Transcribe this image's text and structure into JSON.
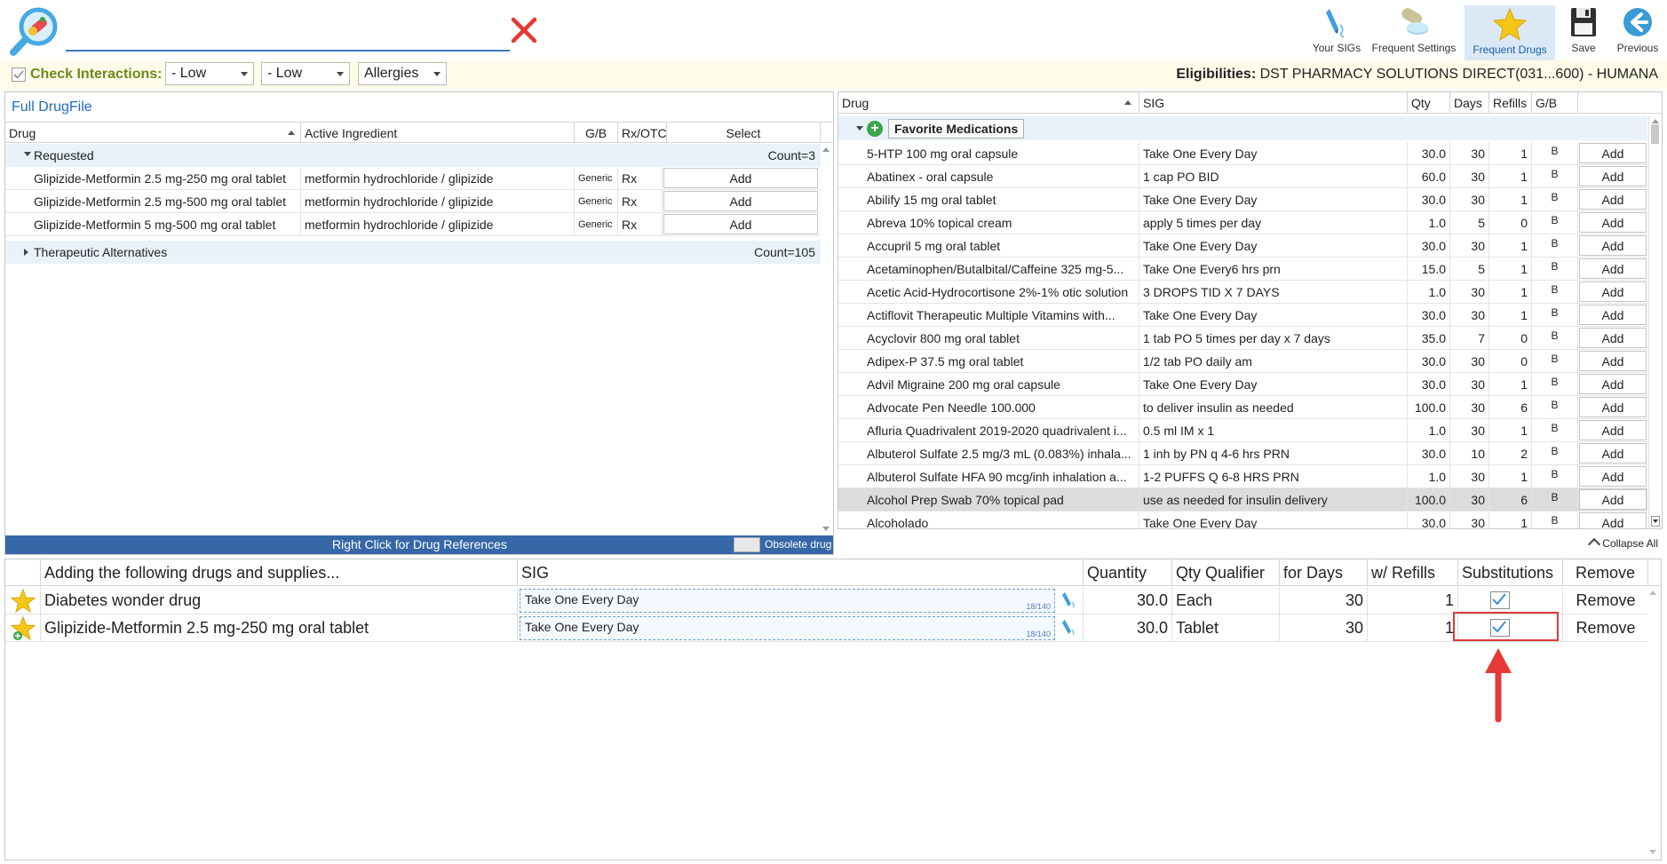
{
  "search": {
    "value": "",
    "placeholder": ""
  },
  "toolbar": {
    "your_sigs": "Your SIGs",
    "frequent_settings": "Frequent Settings",
    "frequent_drugs": "Frequent Drugs",
    "save": "Save",
    "previous": "Previous"
  },
  "interactions": {
    "label": "Check Interactions:",
    "checked": true,
    "severity1": "- Low",
    "severity2": "- Low",
    "allergies": "Allergies"
  },
  "eligibility": {
    "label": "Eligibilities:",
    "value": "DST PHARMACY SOLUTIONS DIRECT(031...600) - HUMANA"
  },
  "left_panel": {
    "title": "Full DrugFile",
    "columns": [
      "Drug",
      "Active Ingredient",
      "G/B",
      "Rx/OTC",
      "Select"
    ],
    "groups": [
      {
        "name": "Requested",
        "count": "Count=3",
        "rows": [
          {
            "drug": "Glipizide-Metformin 2.5 mg-250 mg oral tablet",
            "ingredient": "metformin hydrochloride / glipizide",
            "gb": "Generic",
            "rxotc": "Rx",
            "action": "Add"
          },
          {
            "drug": "Glipizide-Metformin 2.5 mg-500 mg oral tablet",
            "ingredient": "metformin hydrochloride / glipizide",
            "gb": "Generic",
            "rxotc": "Rx",
            "action": "Add"
          },
          {
            "drug": "Glipizide-Metformin 5 mg-500 mg oral tablet",
            "ingredient": "metformin hydrochloride / glipizide",
            "gb": "Generic",
            "rxotc": "Rx",
            "action": "Add"
          }
        ]
      },
      {
        "name": "Therapeutic Alternatives",
        "count": "Count=105"
      }
    ],
    "footer": "Right Click for Drug References",
    "obsolete_label": "Obsolete drug"
  },
  "right_panel": {
    "columns": [
      "Drug",
      "SIG",
      "Qty",
      "Days",
      "Refills",
      "G/B"
    ],
    "group_label": "Favorite Medications",
    "rows": [
      {
        "drug": "5-HTP 100 mg oral capsule",
        "sig": "Take One Every Day",
        "qty": "30.0",
        "days": "30",
        "refills": "1",
        "gb": "B",
        "action": "Add"
      },
      {
        "drug": "Abatinex - oral capsule",
        "sig": "1 cap PO BID",
        "qty": "60.0",
        "days": "30",
        "refills": "1",
        "gb": "B",
        "action": "Add"
      },
      {
        "drug": "Abilify 15 mg oral tablet",
        "sig": "Take One Every Day",
        "qty": "30.0",
        "days": "30",
        "refills": "1",
        "gb": "B",
        "action": "Add"
      },
      {
        "drug": "Abreva 10% topical cream",
        "sig": "apply 5 times per day",
        "qty": "1.0",
        "days": "5",
        "refills": "0",
        "gb": "B",
        "action": "Add"
      },
      {
        "drug": "Accupril 5 mg oral tablet",
        "sig": "Take One Every Day",
        "qty": "30.0",
        "days": "30",
        "refills": "1",
        "gb": "B",
        "action": "Add"
      },
      {
        "drug": "Acetaminophen/Butalbital/Caffeine 325 mg-5...",
        "sig": "Take One Every6 hrs prn",
        "qty": "15.0",
        "days": "5",
        "refills": "1",
        "gb": "B",
        "action": "Add"
      },
      {
        "drug": "Acetic Acid-Hydrocortisone 2%-1% otic solution",
        "sig": "3 DROPS TID X 7 DAYS",
        "qty": "1.0",
        "days": "30",
        "refills": "1",
        "gb": "B",
        "action": "Add"
      },
      {
        "drug": "Actiflovit Therapeutic Multiple Vitamins with...",
        "sig": "Take One Every Day",
        "qty": "30.0",
        "days": "30",
        "refills": "1",
        "gb": "B",
        "action": "Add"
      },
      {
        "drug": "Acyclovir 800 mg oral tablet",
        "sig": "1 tab PO 5 times per day x 7 days",
        "qty": "35.0",
        "days": "7",
        "refills": "0",
        "gb": "B",
        "action": "Add"
      },
      {
        "drug": "Adipex-P 37.5 mg oral tablet",
        "sig": "1/2 tab PO daily am",
        "qty": "30.0",
        "days": "30",
        "refills": "0",
        "gb": "B",
        "action": "Add"
      },
      {
        "drug": "Advil Migraine 200 mg oral capsule",
        "sig": "Take One Every Day",
        "qty": "30.0",
        "days": "30",
        "refills": "1",
        "gb": "B",
        "action": "Add"
      },
      {
        "drug": "Advocate Pen Needle 100.000",
        "sig": "to deliver insulin as needed",
        "qty": "100.0",
        "days": "30",
        "refills": "6",
        "gb": "B",
        "action": "Add"
      },
      {
        "drug": "Afluria Quadrivalent 2019-2020 quadrivalent i...",
        "sig": "0.5 ml IM x 1",
        "qty": "1.0",
        "days": "30",
        "refills": "1",
        "gb": "B",
        "action": "Add"
      },
      {
        "drug": "Albuterol Sulfate 2.5 mg/3 mL (0.083%) inhala...",
        "sig": "1 inh by PN q 4-6 hrs PRN",
        "qty": "30.0",
        "days": "10",
        "refills": "2",
        "gb": "B",
        "action": "Add"
      },
      {
        "drug": "Albuterol Sulfate HFA 90 mcg/inh inhalation a...",
        "sig": "1-2 PUFFS Q 6-8 HRS PRN",
        "qty": "1.0",
        "days": "30",
        "refills": "1",
        "gb": "B",
        "action": "Add"
      },
      {
        "drug": "Alcohol Prep Swab 70% topical pad",
        "sig": "use as needed for insulin delivery",
        "qty": "100.0",
        "days": "30",
        "refills": "6",
        "gb": "B",
        "action": "Add",
        "selected": true
      },
      {
        "drug": "Alcoholado",
        "sig": "Take One Every Day",
        "qty": "30.0",
        "days": "30",
        "refills": "1",
        "gb": "B",
        "action": "Add"
      }
    ],
    "collapse_label": "Collapse All"
  },
  "bottom_panel": {
    "columns": [
      "Adding the following drugs and supplies...",
      "SIG",
      "Quantity",
      "Qty Qualifier",
      "for Days",
      "w/ Refills",
      "Substitutions",
      "Remove"
    ],
    "rows": [
      {
        "drug": "Diabetes wonder drug",
        "sig": "Take One Every Day",
        "sig_count": "18/140",
        "quantity": "30.0",
        "qualifier": "Each",
        "days": "30",
        "refills": "1",
        "substitutions": true,
        "remove": "Remove"
      },
      {
        "drug": "Glipizide-Metformin 2.5 mg-250 mg oral tablet",
        "sig": "Take One Every Day",
        "sig_count": "18/140",
        "quantity": "30.0",
        "qualifier": "Tablet",
        "days": "30",
        "refills": "1",
        "substitutions": true,
        "remove": "Remove"
      }
    ]
  },
  "colors": {
    "accent": "#1e6bc0",
    "footer_bar": "#3668a8",
    "group_bg": "#e9f2fb",
    "interaction_label": "#6a8a1a",
    "highlight": "#e03a3a",
    "star": "#f5c518"
  }
}
